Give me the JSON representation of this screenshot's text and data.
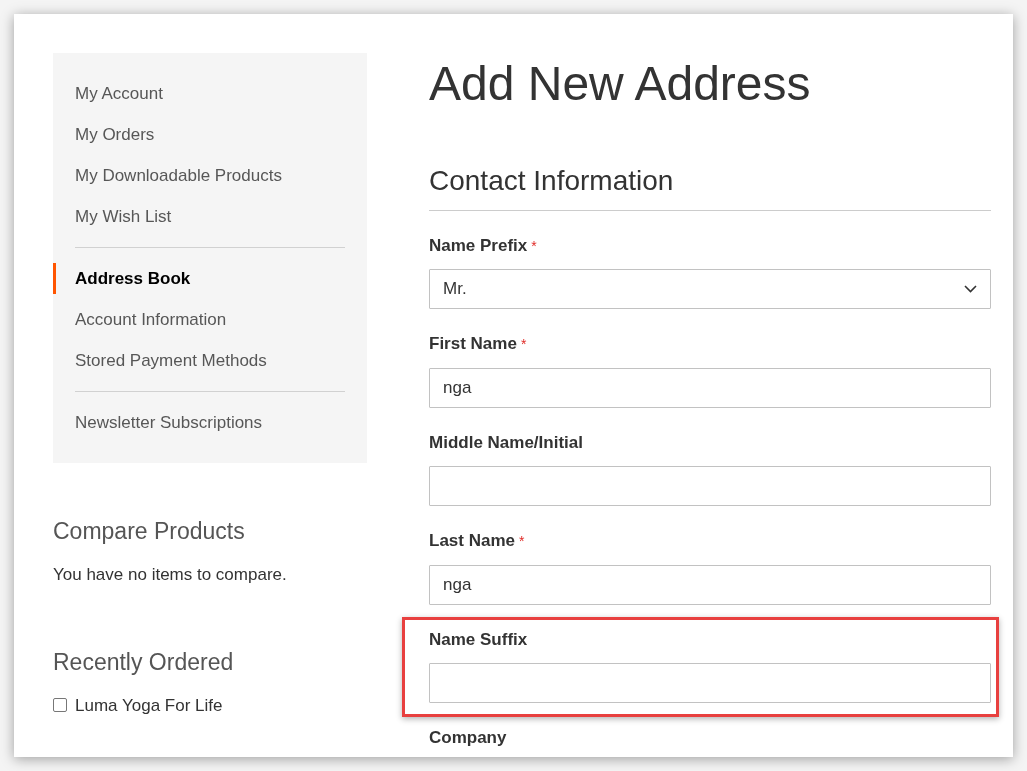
{
  "sidebar": {
    "groups": [
      {
        "items": [
          {
            "label": "My Account",
            "selected": false
          },
          {
            "label": "My Orders",
            "selected": false
          },
          {
            "label": "My Downloadable Products",
            "selected": false
          },
          {
            "label": "My Wish List",
            "selected": false
          }
        ]
      },
      {
        "items": [
          {
            "label": "Address Book",
            "selected": true
          },
          {
            "label": "Account Information",
            "selected": false
          },
          {
            "label": "Stored Payment Methods",
            "selected": false
          }
        ]
      },
      {
        "items": [
          {
            "label": "Newsletter Subscriptions",
            "selected": false
          }
        ]
      }
    ]
  },
  "compare": {
    "title": "Compare Products",
    "message": "You have no items to compare."
  },
  "recently_ordered": {
    "title": "Recently Ordered",
    "items": [
      {
        "label": "Luma Yoga For Life",
        "checked": false
      }
    ]
  },
  "page_title": "Add New Address",
  "section_title": "Contact Information",
  "fields": [
    {
      "kind": "select",
      "label": "Name Prefix",
      "required_mark": "*",
      "value": "Mr.",
      "highlighted": false
    },
    {
      "kind": "text",
      "label": "First Name",
      "required_mark": "*",
      "value": "nga",
      "highlighted": false
    },
    {
      "kind": "text",
      "label": "Middle Name/Initial",
      "highlighted": false
    },
    {
      "kind": "text",
      "label": "Last Name",
      "required_mark": "*",
      "value": "nga",
      "highlighted": false
    },
    {
      "kind": "text",
      "label": "Name Suffix",
      "highlighted": true
    },
    {
      "kind": "text",
      "label": "Company",
      "highlighted": false
    }
  ]
}
